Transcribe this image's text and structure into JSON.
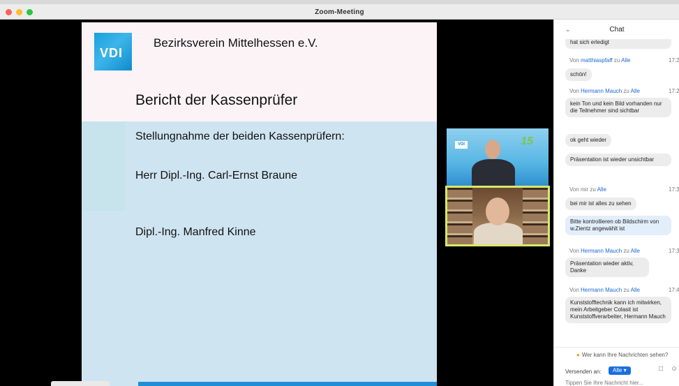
{
  "window": {
    "title": "Zoom-Meeting",
    "lights": [
      "#fe5f57",
      "#febc2e",
      "#28c840"
    ]
  },
  "slide": {
    "logo_text": "VDI",
    "org": "Bezirksverein Mittelhessen e.V.",
    "title": "Bericht der Kassenprüfer",
    "lines": [
      "Stellungnahme der beiden Kassenprüfern:",
      "Herr Dipl.-Ing. Carl-Ernst Braune",
      "Dipl.-Ing. Manfred Kinne"
    ]
  },
  "video_tiles": [
    {
      "badge": "VDI",
      "overlay": "15"
    },
    {
      "badge": ""
    }
  ],
  "chat": {
    "title": "Chat",
    "messages": [
      {
        "text": "hat sich erledigt"
      },
      {
        "from": "Von ",
        "sender": "matthiaspfaff",
        "to_word": " zu ",
        "recipient": "Alle",
        "time": "17:2",
        "text": "schön!"
      },
      {
        "from": "Von ",
        "sender": "Hermann Mauch",
        "to_word": " zu ",
        "recipient": "Alle",
        "time": "17:2",
        "text": "kein Ton und kein Bild vorhanden nur die Teilnehmer sind sichtbar"
      },
      {
        "text": "ok geht wieder"
      },
      {
        "text": "Präsentation ist wieder unsichtbar"
      },
      {
        "from": "Von ",
        "sender": "mir",
        "to_word": " zu ",
        "recipient": "Alle",
        "time": "17:3",
        "text": "bei mir ist alles zu sehen"
      },
      {
        "text": "Bitte kontrollieren ob Bildschirm von w.Zientz angewählt ist"
      },
      {
        "from": "Von ",
        "sender": "Hermann Mauch",
        "to_word": " zu ",
        "recipient": "Alle",
        "time": "17:3",
        "text": "Präsentation wieder aktiv, Danke"
      },
      {
        "from": "Von ",
        "sender": "Hermann Mauch",
        "to_word": " zu ",
        "recipient": "Alle",
        "time": "17:4",
        "text": "Kunststofftechnik kann ich mitwirken, mein Arbeitgeber Colasit ist Kunststoffverarbeiter, Hermann Mauch"
      }
    ],
    "who_can_see": "Wer kann Ihre Nachrichten sehen?",
    "send_to_label": "Versenden an:",
    "send_to_value": "Alle",
    "input_placeholder": "Tippen Sie Ihre Nachricht hier..."
  }
}
